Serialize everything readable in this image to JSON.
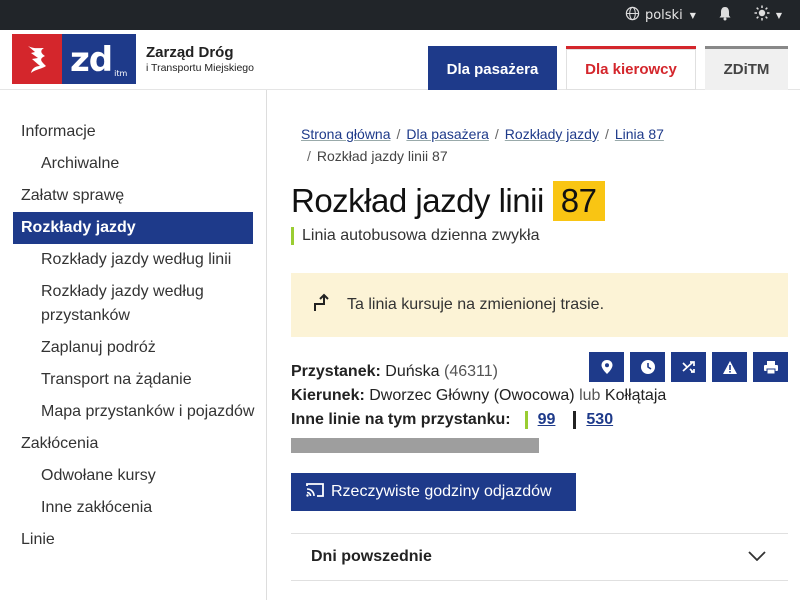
{
  "topbar": {
    "language": "polski",
    "icons": [
      "globe-icon",
      "bell-icon",
      "sun-icon"
    ]
  },
  "header": {
    "logo_zd": "zd",
    "logo_itm": "itm",
    "logo_title": "Zarząd Dróg",
    "logo_subtitle": "i Transportu Miejskiego",
    "tabs": [
      {
        "label": "Dla pasażera"
      },
      {
        "label": "Dla kierowcy"
      },
      {
        "label": "ZDiTM"
      }
    ]
  },
  "sidebar": {
    "items": [
      {
        "label": "Informacje"
      },
      {
        "label": "Archiwalne"
      },
      {
        "label": "Załatw sprawę"
      },
      {
        "label": "Rozkłady jazdy"
      },
      {
        "label": "Rozkłady jazdy według linii"
      },
      {
        "label": "Rozkłady jazdy według przystanków"
      },
      {
        "label": "Zaplanuj podróż"
      },
      {
        "label": "Transport na żądanie"
      },
      {
        "label": "Mapa przystanków i pojazdów"
      },
      {
        "label": "Zakłócenia"
      },
      {
        "label": "Odwołane kursy"
      },
      {
        "label": "Inne zakłócenia"
      },
      {
        "label": "Linie"
      }
    ]
  },
  "breadcrumb": {
    "items": [
      "Strona główna",
      "Dla pasażera",
      "Rozkłady jazdy",
      "Linia 87"
    ],
    "current": "Rozkład jazdy linii 87"
  },
  "page": {
    "title": "Rozkład jazdy linii",
    "line_number": "87",
    "line_type": "Linia autobusowa dzienna zwykła",
    "notice": "Ta linia kursuje na zmienionej trasie."
  },
  "stop": {
    "stop_label": "Przystanek:",
    "stop_name": "Duńska",
    "stop_code": "(46311)",
    "direction_label": "Kierunek:",
    "direction_main": "Dworzec Główny (Owocowa)",
    "direction_or": "lub",
    "direction_alt": "Kołłątaja",
    "other_lines_label": "Inne linie na tym przystanku:",
    "other_lines": [
      "99",
      "530"
    ]
  },
  "realtime_button": "Rzeczywiste godziny odjazdów",
  "accordion": {
    "label": "Dni powszednie"
  },
  "colors": {
    "brand_blue": "#1e3a8a",
    "brand_red": "#d4262c",
    "line_badge": "#f9c513",
    "notice_bg": "#fcf3d6",
    "bus_line_accent": "#9acd32"
  }
}
